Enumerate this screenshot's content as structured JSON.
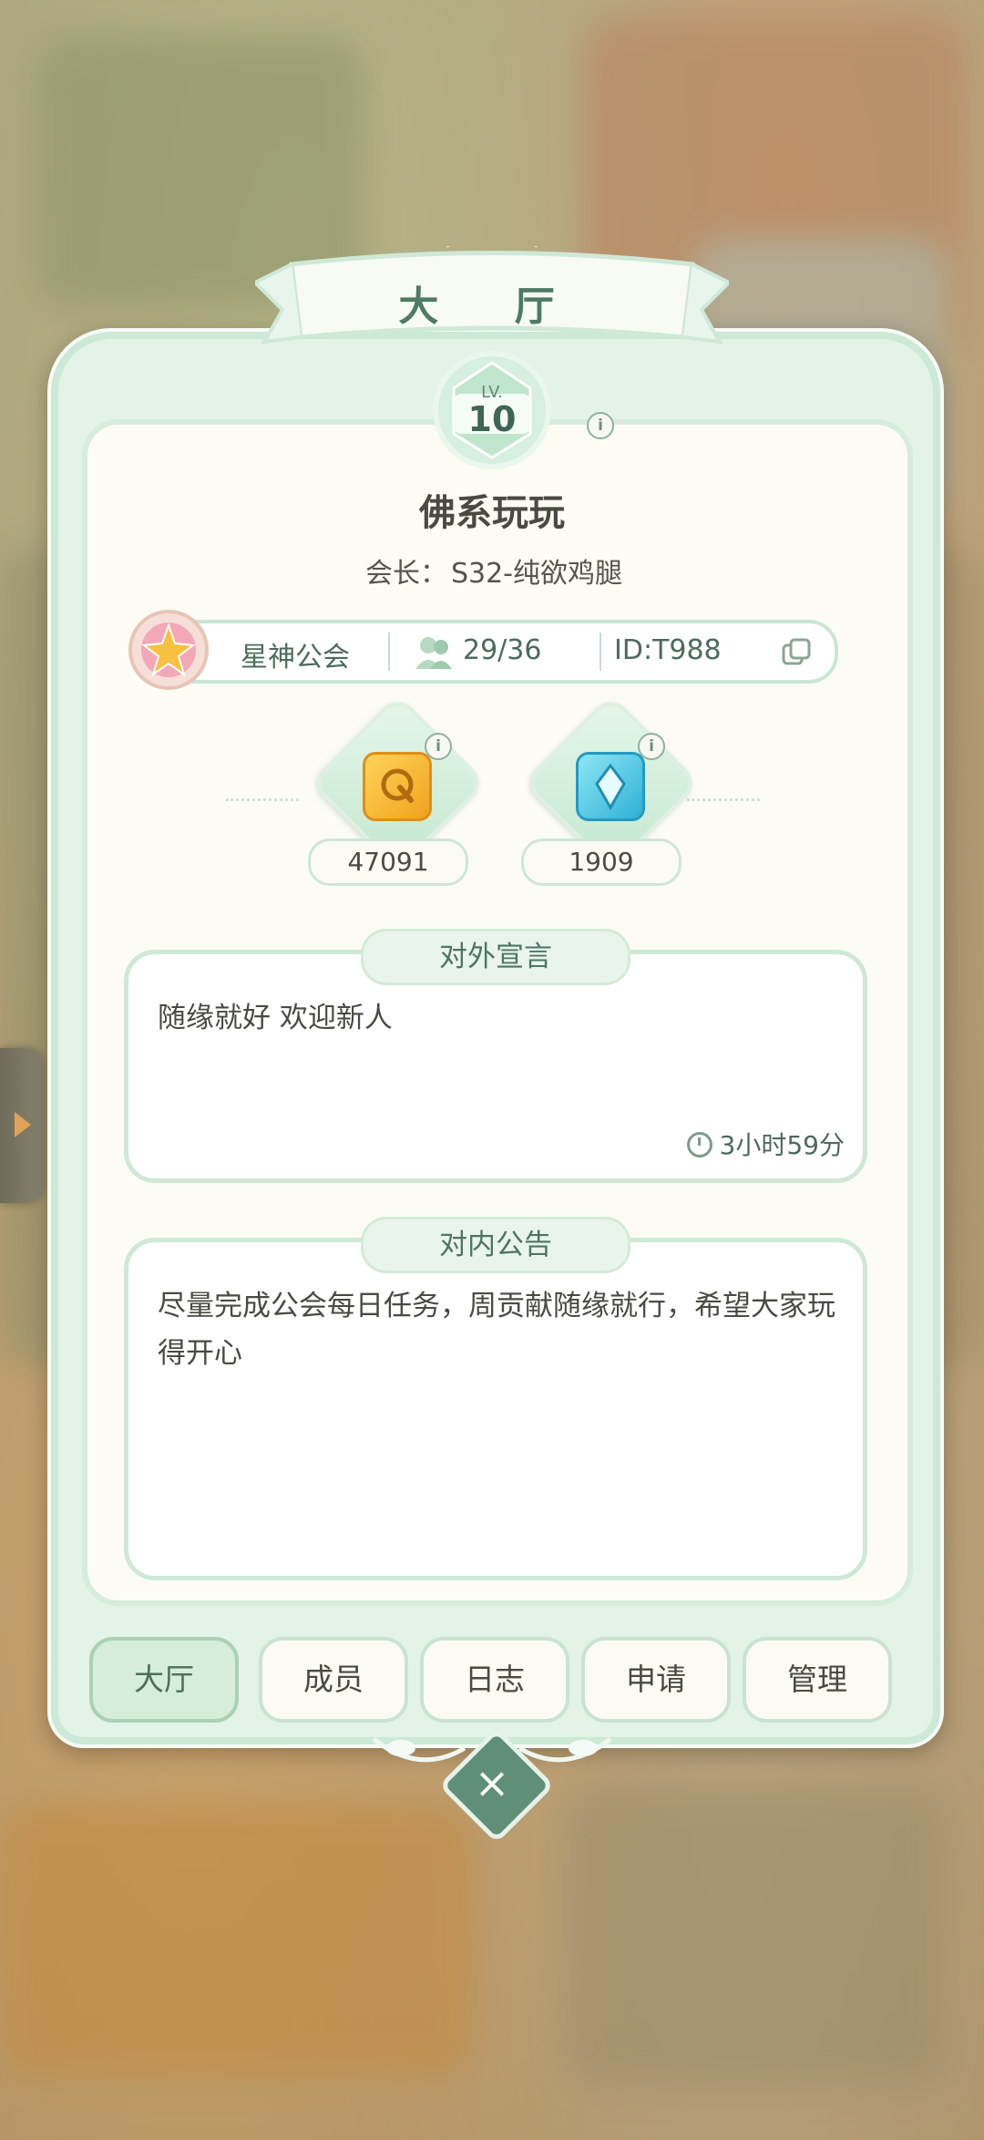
{
  "header": {
    "title": "大 厅"
  },
  "level": {
    "prefix": "LV.",
    "value": "10"
  },
  "guild": {
    "name": "佛系玩玩",
    "leader_label": "会长：",
    "leader_name": "S32-纯欲鸡腿",
    "type": "星神公会",
    "members": "29/36",
    "id": "ID:T988"
  },
  "resources": [
    {
      "icon": "coin-icon",
      "value": "47091",
      "color": "#f2b233"
    },
    {
      "icon": "crystal-icon",
      "value": "1909",
      "color": "#49bfe0"
    }
  ],
  "manifesto": {
    "title": "对外宣言",
    "text": "随缘就好 欢迎新人",
    "time": "3小时59分"
  },
  "announcement": {
    "title": "对内公告",
    "text": "尽量完成公会每日任务，周贡献随缘就行，希望大家玩得开心"
  },
  "tabs": [
    "大厅",
    "成员",
    "日志",
    "申请",
    "管理"
  ],
  "colors": {
    "accent": "#5f8f78",
    "panel": "#e3f3e8"
  }
}
